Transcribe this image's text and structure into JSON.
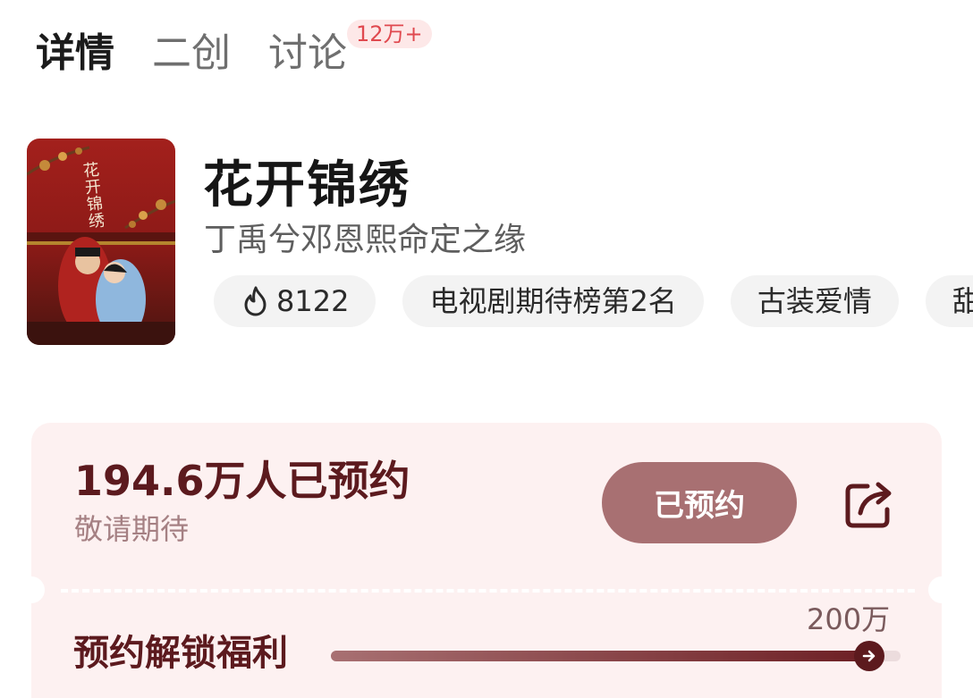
{
  "tabs": [
    {
      "label": "详情",
      "active": true
    },
    {
      "label": "二创",
      "active": false
    },
    {
      "label": "讨论",
      "active": false,
      "badge": "12万+"
    }
  ],
  "show": {
    "title": "花开锦绣",
    "subtitle": "丁禹兮邓恩熙命定之缘",
    "poster_text": "花开锦绣",
    "tags": [
      {
        "icon": "fire-icon",
        "label": "8122"
      },
      {
        "label": "电视剧期待榜第2名"
      },
      {
        "label": "古装爱情"
      },
      {
        "label": "甜"
      }
    ]
  },
  "reservation": {
    "count_text": "194.6万人已预约",
    "note": "敬请期待",
    "button_label": "已预约",
    "share_icon": "share-icon",
    "unlock_label": "预约解锁福利",
    "goal_label": "200万",
    "progress": 0.95
  },
  "colors": {
    "accent_dark": "#5c1a1e",
    "button_bg": "#a87072",
    "card_bg": "#fdf1f1",
    "badge_text": "#e0494f"
  }
}
